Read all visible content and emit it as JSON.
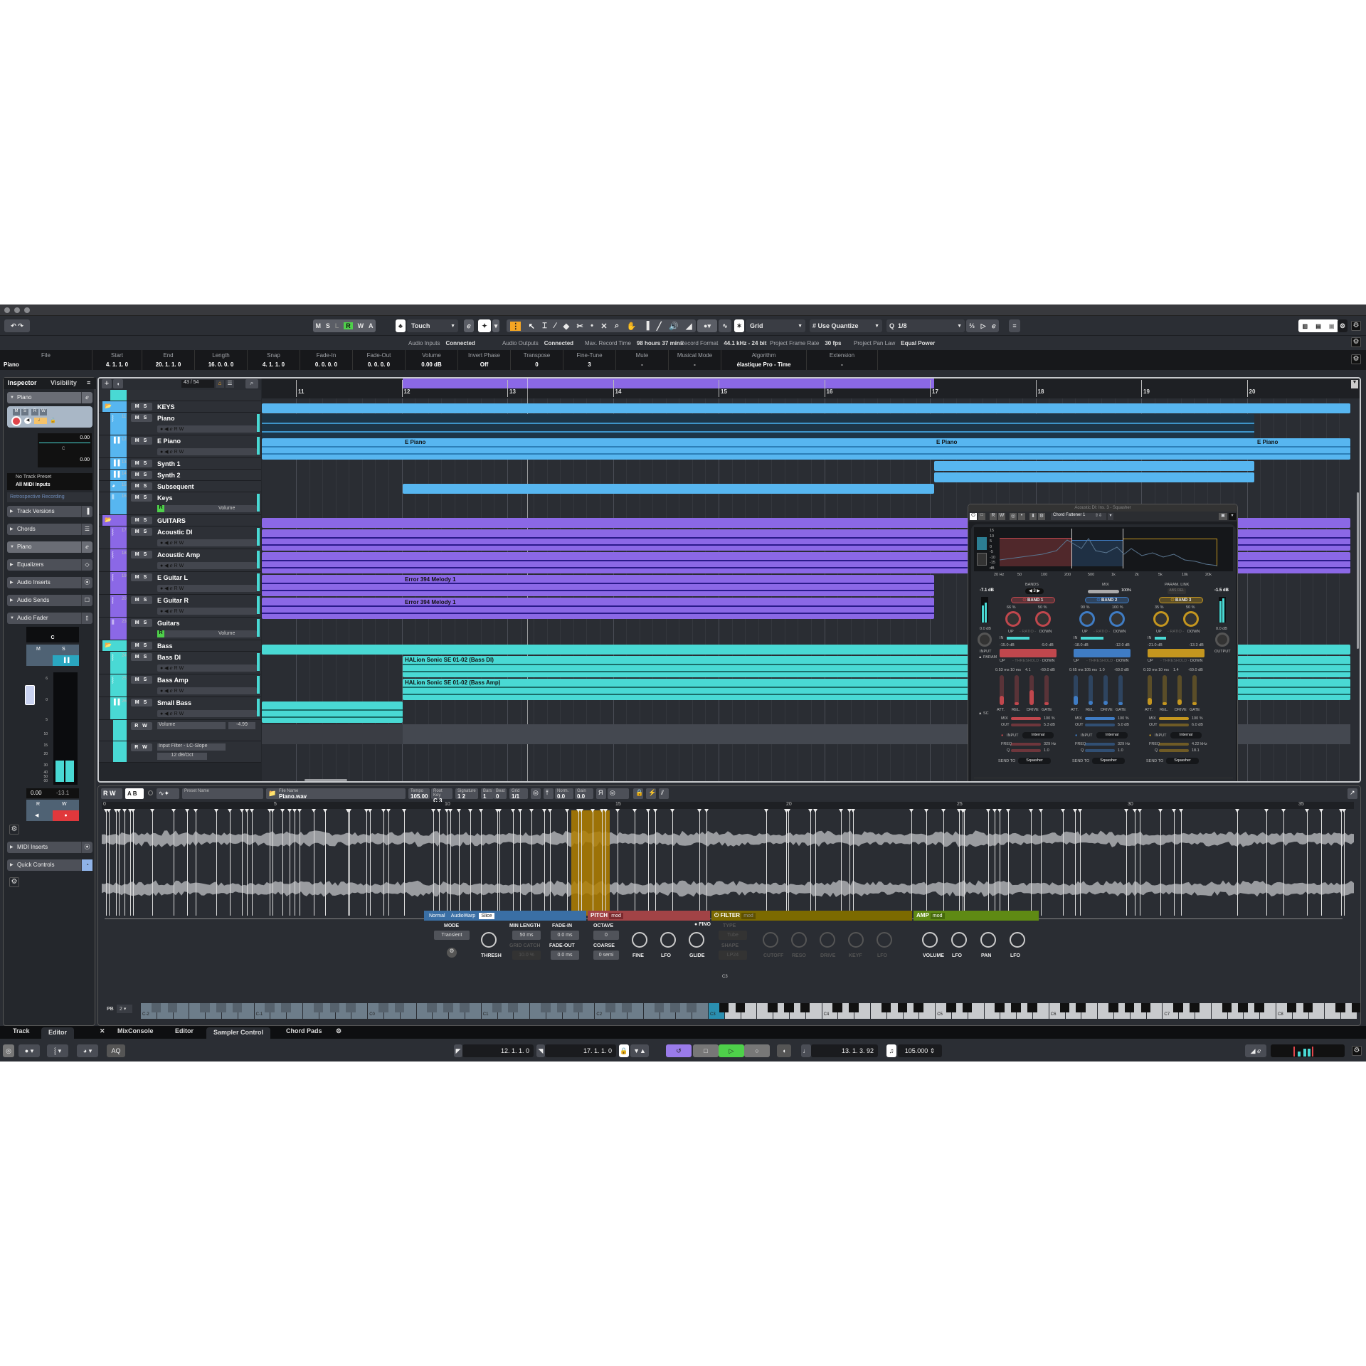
{
  "window": {
    "title": ""
  },
  "toolbar": {
    "undo": "undo-icon",
    "redo": "redo-icon",
    "automation_buttons": [
      "M",
      "S",
      "L",
      "R",
      "W",
      "A"
    ],
    "automation_mode": "Touch",
    "snap_type": "Grid",
    "quantize_mode": "Use Quantize",
    "quantize_value": "1/8",
    "colors": {
      "active_green": "#4ed04a",
      "accent_orange": "#f5a623",
      "accent_purple": "#8b68e6"
    }
  },
  "status_bar": [
    {
      "label": "Audio Inputs",
      "value": "Connected"
    },
    {
      "label": "Audio Outputs",
      "value": "Connected"
    },
    {
      "label": "Max. Record Time",
      "value": "98 hours 37 mins"
    },
    {
      "label": "Record Format",
      "value": "44.1 kHz - 24 bit"
    },
    {
      "label": "Project Frame Rate",
      "value": "30 fps"
    },
    {
      "label": "Project Pan Law",
      "value": "Equal Power"
    }
  ],
  "info_line": [
    {
      "h": "File",
      "v": "Piano"
    },
    {
      "h": "Start",
      "v": "4. 1. 1.   0"
    },
    {
      "h": "End",
      "v": "20. 1. 1.   0"
    },
    {
      "h": "Length",
      "v": "16. 0. 0.   0"
    },
    {
      "h": "Snap",
      "v": "4. 1. 1.   0"
    },
    {
      "h": "Fade-In",
      "v": "0. 0. 0.   0"
    },
    {
      "h": "Fade-Out",
      "v": "0. 0. 0.   0"
    },
    {
      "h": "Volume",
      "v": "0.00        dB"
    },
    {
      "h": "Invert Phase",
      "v": "Off"
    },
    {
      "h": "Transpose",
      "v": "0"
    },
    {
      "h": "Fine-Tune",
      "v": "3"
    },
    {
      "h": "Mute",
      "v": "-"
    },
    {
      "h": "Musical Mode",
      "v": "-"
    },
    {
      "h": "Algorithm",
      "v": "élastique Pro - Time"
    },
    {
      "h": "Extension",
      "v": "-"
    }
  ],
  "inspector": {
    "tabs": [
      "Inspector",
      "Visibility"
    ],
    "track_name": "Piano",
    "volume": "0.00",
    "pan": "C",
    "pan_value": "0.00",
    "track_preset": "No Track Preset",
    "midi_input": "All MIDI Inputs",
    "retro": "Retrospective Recording",
    "sections": [
      "Track Versions",
      "Chords",
      "Piano",
      "Equalizers",
      "Audio Inserts",
      "Audio Sends",
      "Audio Fader",
      "MIDI Inserts",
      "Quick Controls"
    ],
    "fader_pan": "C",
    "fader_value": "0.00",
    "fader_peak": "-13.1",
    "fader_scale": [
      "6",
      "0",
      "5",
      "10",
      "15",
      "20",
      "30",
      "40",
      "50",
      "00"
    ]
  },
  "tracklist": {
    "counter": "43 / 54",
    "tracks": [
      {
        "name": "",
        "num": "",
        "type": "automation",
        "color": "#49d9d4",
        "label": "Volume"
      },
      {
        "name": "KEYS",
        "num": "",
        "type": "folder",
        "color": "#57b6f0"
      },
      {
        "name": "Piano",
        "num": "11",
        "type": "audio",
        "color": "#57b6f0"
      },
      {
        "name": "E Piano",
        "num": "12",
        "type": "instrument",
        "color": "#57b6f0"
      },
      {
        "name": "Synth 1",
        "num": "13",
        "type": "instrument",
        "color": "#57b6f0"
      },
      {
        "name": "Synth 2",
        "num": "14",
        "type": "instrument",
        "color": "#57b6f0"
      },
      {
        "name": "Subsequent",
        "num": "15",
        "type": "sampler",
        "color": "#57b6f0"
      },
      {
        "name": "Keys",
        "num": "16",
        "type": "group",
        "color": "#57b6f0",
        "label": "Volume"
      },
      {
        "name": "GUITARS",
        "num": "",
        "type": "folder",
        "color": "#8b68e6"
      },
      {
        "name": "Acoustic DI",
        "num": "17",
        "type": "audio",
        "color": "#8b68e6"
      },
      {
        "name": "Acoustic Amp",
        "num": "18",
        "type": "audio",
        "color": "#8b68e6"
      },
      {
        "name": "E Guitar L",
        "num": "19",
        "type": "audio",
        "color": "#8b68e6"
      },
      {
        "name": "E Guitar R",
        "num": "20",
        "type": "audio",
        "color": "#8b68e6"
      },
      {
        "name": "Guitars",
        "num": "23",
        "type": "group",
        "color": "#8b68e6",
        "label": "Volume"
      },
      {
        "name": "Bass",
        "num": "",
        "type": "folder",
        "color": "#49d9d4"
      },
      {
        "name": "Bass DI",
        "num": "24",
        "type": "audio",
        "color": "#49d9d4"
      },
      {
        "name": "Bass Amp",
        "num": "25",
        "type": "audio",
        "color": "#49d9d4"
      },
      {
        "name": "Small Bass",
        "num": "26",
        "type": "instrument",
        "color": "#49d9d4"
      }
    ],
    "automation_lanes": [
      {
        "param": "Volume",
        "value": "-4.99"
      },
      {
        "param": "Input Filter - LC-Slope",
        "value": "12 dB/Oct"
      }
    ]
  },
  "ruler": {
    "bars": [
      "11",
      "12",
      "13",
      "14",
      "15",
      "16",
      "17",
      "18",
      "19",
      "20"
    ],
    "loop_start": "12",
    "loop_end": "17"
  },
  "clips": {
    "epiano_labels": [
      "E Piano",
      "E Piano",
      "E Piano"
    ],
    "guitar_label": "Error 394 Melody 1",
    "bass_di": "HALion Sonic SE 01-02 (Bass DI)",
    "bass_amp": "HALion Sonic SE 01-02 (Bass Amp)"
  },
  "plugin": {
    "title": "Acoustic DI: Ins. 3 - Squasher",
    "preset": "Chord Fattener 1",
    "freq_axis": [
      "20 Hz",
      "50",
      "100",
      "200",
      "500",
      "1k",
      "2k",
      "5k",
      "10k",
      "20k"
    ],
    "db_axis": [
      "15",
      "10",
      "5",
      "0",
      "-5",
      "-10",
      "-15",
      "dB"
    ],
    "input_db": "-7.1 dB",
    "output_db": "-1.5 dB",
    "input_gain": "0.0 dB",
    "output_gain": "0.0 dB",
    "input_label": "INPUT",
    "output_label": "OUTPUT",
    "bands_label": "BANDS",
    "bands_value": "3",
    "mix_label": "MIX",
    "mix_value": "100%",
    "param_link": "PARAM. LINK",
    "param_link_opts": [
      "ABS",
      "REL"
    ],
    "param_label": "PARAM",
    "sc_label": "SC",
    "bands": [
      {
        "name": "BAND 1",
        "color": "#c0474d",
        "up_ratio": "66 %",
        "down_ratio": "50 %",
        "thr_up": "-15.0 dB",
        "thr_down": "-9.0 dB",
        "att": "0.53 ms",
        "rel": "10 ms",
        "drive": "4.1",
        "gate": "-60.0 dB",
        "mix": "100 %",
        "out": "5.3 dB",
        "input": "Internal",
        "freq": "329 Hz",
        "q": "1.0",
        "send": "Squasher"
      },
      {
        "name": "BAND 2",
        "color": "#3f7cc4",
        "up_ratio": "90 %",
        "down_ratio": "100 %",
        "thr_up": "-18.0 dB",
        "thr_down": "-12.0 dB",
        "att": "0.65 ms",
        "rel": "105 ms",
        "drive": "1.0",
        "gate": "-60.0 dB",
        "mix": "100 %",
        "out": "5.0 dB",
        "input": "Internal",
        "freq": "329 Hz",
        "q": "1.0",
        "send": "Squasher"
      },
      {
        "name": "BAND 3",
        "color": "#c4961f",
        "up_ratio": "35 %",
        "down_ratio": "50 %",
        "thr_up": "-21.0 dB",
        "thr_down": "-13.3 dB",
        "att": "0.33 ms",
        "rel": "10 ms",
        "drive": "1.4",
        "gate": "-60.0 dB",
        "mix": "100 %",
        "out": "6.0 dB",
        "input": "Internal",
        "freq": "4.22 kHz",
        "q": "18.1",
        "send": "Squasher"
      }
    ],
    "labels": {
      "up": "UP",
      "down": "DOWN",
      "ratio": "- RATIO -",
      "threshold": "- THRESHOLD -",
      "in": "IN",
      "att": "ATT.",
      "rel": "REL.",
      "drive": "DRIVE",
      "gate": "GATE",
      "mix": "MIX",
      "out": "OUT",
      "input": "INPUT",
      "freq": "FREQ",
      "q": "Q",
      "send_to": "SEND TO"
    },
    "brand": "steinberg",
    "product": "squasher"
  },
  "editor": {
    "preset_placeholder": "Preset Name",
    "file_label": "File Name",
    "file": "Piano.wav",
    "tempo_label": "Tempo",
    "tempo": "105.00",
    "rootkey_label": "Root Key",
    "rootkey": "C 3",
    "sig_label": "Signature",
    "sig": "1  2",
    "bars_label": "Bars",
    "bars": "1",
    "beat_label": "Beat",
    "beat": "0",
    "grid_label": "Grid",
    "grid": "1/1",
    "norm_label": "Norm.",
    "norm": "0.0",
    "gain_label": "Gain",
    "gain": "0.0",
    "ruler": [
      "0",
      "5",
      "10",
      "15",
      "20",
      "25",
      "30",
      "35"
    ]
  },
  "sampler": {
    "playback_modes": [
      "Normal",
      "AudioWarp",
      "Slice"
    ],
    "mode_label": "MODE",
    "mode": "Transient",
    "thresh": "THRESH",
    "min_length_label": "MIN LENGTH",
    "min_length": "50 ms",
    "grid_catch_label": "GRID CATCH",
    "grid_catch": "10.0 %",
    "fade_in_label": "FADE-IN",
    "fade_in": "0.0 ms",
    "fade_out_label": "FADE-OUT",
    "fade_out": "0.0 ms",
    "pitch": {
      "title": "PITCH",
      "mod": "mod",
      "octave_label": "OCTAVE",
      "octave": "0",
      "coarse_label": "COARSE",
      "coarse": "0 semi",
      "knobs": [
        "FINE",
        "LFO",
        "GLIDE"
      ],
      "fino": "FINO"
    },
    "filter": {
      "title": "FILTER",
      "mod": "mod",
      "type_label": "TYPE",
      "type": "Tube",
      "shape_label": "SHAPE",
      "shape": "LP24",
      "knobs": [
        "CUTOFF",
        "RESO",
        "DRIVE",
        "KEYF",
        "LFO"
      ]
    },
    "amp": {
      "title": "AMP",
      "mod": "mod",
      "knobs": [
        "VOLUME",
        "LFO",
        "PAN",
        "LFO"
      ]
    },
    "colors": {
      "slice": "#3a6fa5",
      "pitch": "#a24346",
      "filter": "#7c6a00",
      "amp": "#5f8a14",
      "selection": "#b07f00"
    }
  },
  "keyboard": {
    "pb_label": "PB",
    "pb": "2",
    "root": "C3",
    "octaves": [
      "C-2",
      "C-1",
      "C0",
      "C1",
      "C2",
      "C3",
      "C4",
      "C5",
      "C6",
      "C7",
      "C8"
    ]
  },
  "bottom_tabs": {
    "left": [
      "Track",
      "Editor"
    ],
    "right": [
      "MixConsole",
      "Editor",
      "Sampler Control",
      "Chord Pads"
    ],
    "active_left": "Editor",
    "active_right": "Sampler Control"
  },
  "transport": {
    "left_locator": "12.  1.  1.    0",
    "right_locator": "17.  1.  1.    0",
    "position": "13.  1.  3.  92",
    "tempo": "105.000",
    "aq": "AQ"
  }
}
